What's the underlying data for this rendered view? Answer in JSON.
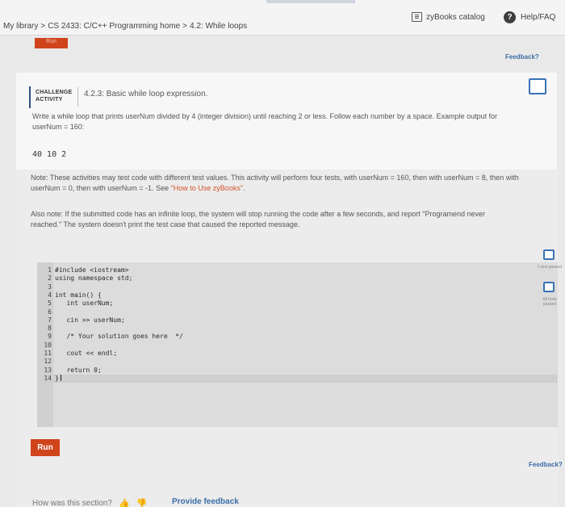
{
  "header": {
    "breadcrumb": [
      "My library",
      "CS 2433: C/C++ Programming home",
      "4.2: While loops"
    ],
    "catalog_label": "zyBooks catalog",
    "help_label": "Help/FAQ",
    "help_glyph": "?"
  },
  "top_tab_label": "Run",
  "feedback_label": "Feedback?",
  "challenge": {
    "tag_line1": "CHALLENGE",
    "tag_line2": "ACTIVITY",
    "title": "4.2.3: Basic while loop expression.",
    "instructions": "Write a while loop that prints userNum divided by 4 (integer division) until reaching 2 or less. Follow each number by a space. Example output for userNum = 160:",
    "example_output": "40 10 2"
  },
  "notes": {
    "note_text": "Note: These activities may test code with different test values. This activity will perform four tests, with userNum = 160, then with userNum = 8, then with userNum = 0, then with userNum = -1. See ",
    "note_link": "\"How to Use zyBooks\"",
    "note_end": ".",
    "note2": "Also note: If the submitted code has an infinite loop, the system will stop running the code after a few seconds, and report \"Programend never reached.\" The system doesn't print the test case that caused the reported message."
  },
  "code_lines": [
    {
      "n": "1",
      "t": "#include <iostream>"
    },
    {
      "n": "2",
      "t": "using namespace std;"
    },
    {
      "n": "3",
      "t": ""
    },
    {
      "n": "4",
      "t": "int main() {"
    },
    {
      "n": "5",
      "t": "   int userNum;"
    },
    {
      "n": "6",
      "t": ""
    },
    {
      "n": "7",
      "t": "   cin >> userNum;"
    },
    {
      "n": "8",
      "t": ""
    },
    {
      "n": "9",
      "t": "   /* Your solution goes here  */"
    },
    {
      "n": "10",
      "t": ""
    },
    {
      "n": "11",
      "t": "   cout << endl;"
    },
    {
      "n": "12",
      "t": ""
    },
    {
      "n": "13",
      "t": "   return 0;"
    },
    {
      "n": "14",
      "t": "}"
    }
  ],
  "tests": {
    "test1_label": "1 test passed",
    "all_label": "All tests passed"
  },
  "run_label": "Run",
  "rating": {
    "question": "How was this section?",
    "provide_feedback": "Provide feedback"
  }
}
